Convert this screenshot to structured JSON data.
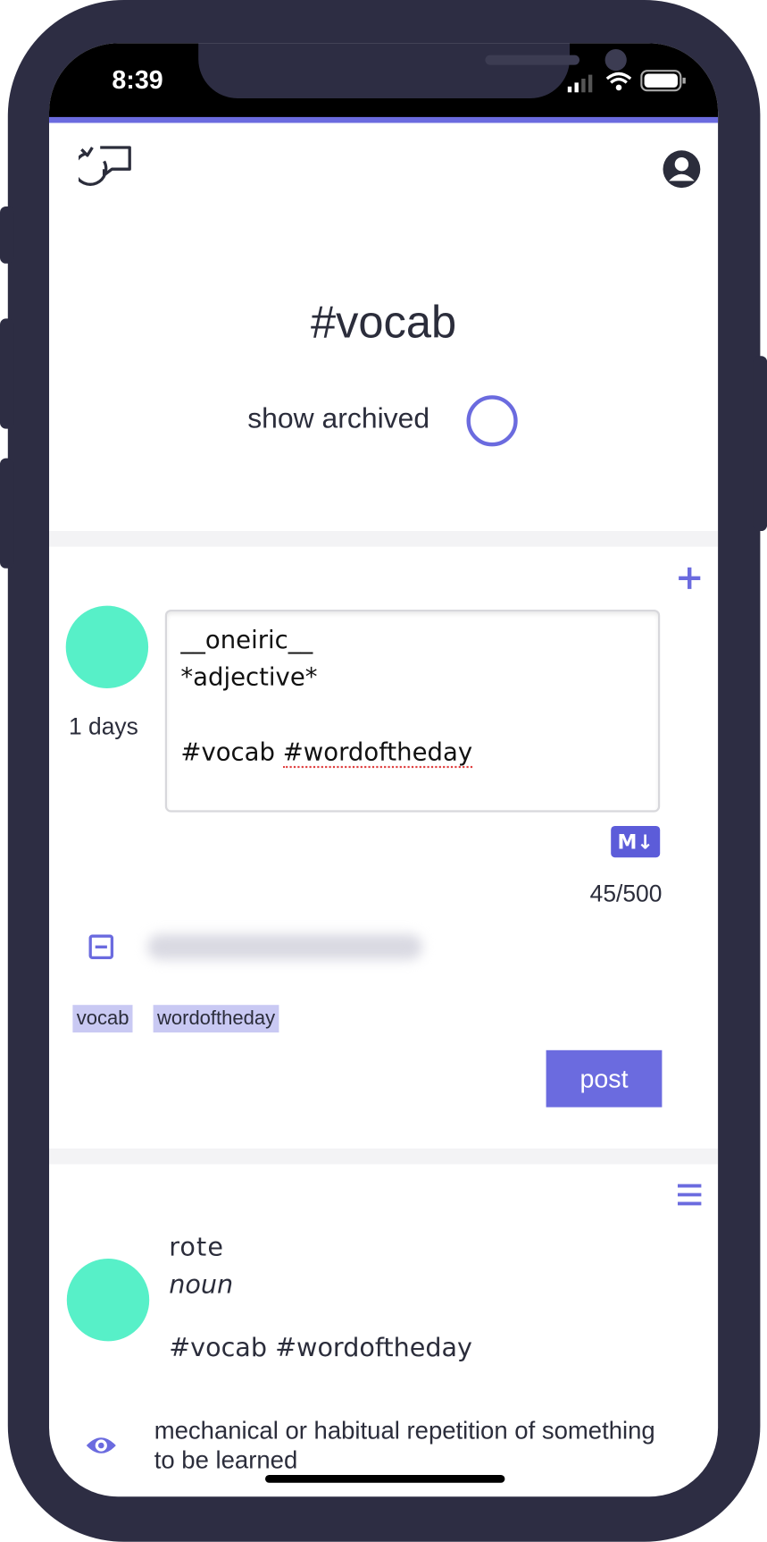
{
  "status_bar": {
    "time": "8:39"
  },
  "header": {
    "title": "#vocab",
    "show_archived_label": "show archived"
  },
  "composer": {
    "age": "1 days",
    "text_line1": "__oneiric__",
    "text_line2": "*adjective*",
    "text_line4_tag1": "#vocab",
    "text_line4_tag2": "#wordoftheday",
    "markdown_badge": "M↓",
    "char_count": "45/500",
    "tags": [
      "vocab",
      "wordoftheday"
    ],
    "post_label": "post"
  },
  "entry": {
    "word": "rote",
    "part_of_speech": "noun",
    "hashtags": "#vocab #wordoftheday",
    "definition": "mechanical or habitual repetition of something to be learned"
  },
  "colors": {
    "accent": "#6b6bdf",
    "avatar": "#57f0c8",
    "frame": "#2d2d43",
    "tag_bg": "#c9c9f3"
  },
  "icons": [
    "rotate-chat-icon",
    "account-icon",
    "plus-icon",
    "collapse-icon",
    "menu-icon",
    "eye-icon",
    "signal-icon",
    "wifi-icon",
    "battery-icon"
  ]
}
